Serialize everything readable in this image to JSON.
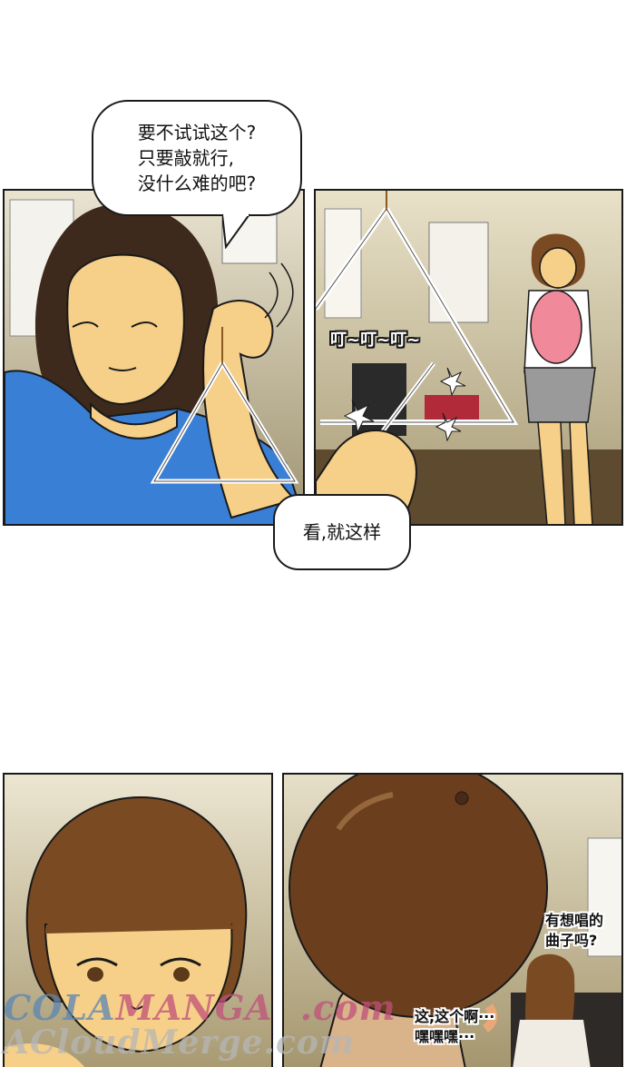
{
  "bubbles": {
    "top": "要不试试这个?\n只要敲就行,\n没什么难的吧?",
    "middle": "看,就这样"
  },
  "sfx": {
    "ting": "叮~叮~叮~"
  },
  "panel4": {
    "line1": "有想唱的\n曲子吗?",
    "line2": "这,这个啊···\n嘿嘿嘿···"
  },
  "watermark": {
    "line1_a": "COLA",
    "line1_b": "MANGA",
    "line1_c": ".com",
    "line2": "ACloudMerge.com"
  },
  "colors": {
    "shirt_blue": "#3a7fd6",
    "skin": "#f6cf88",
    "hair_dark": "#3d2a1c",
    "hair_brown": "#7a4a22",
    "room_bg": "#cfc6a4"
  }
}
